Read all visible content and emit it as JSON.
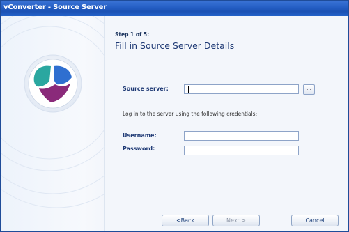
{
  "window": {
    "title": "vConverter - Source Server"
  },
  "wizard": {
    "step_label": "Step 1 of 5:",
    "heading": "Fill in Source Server Details"
  },
  "form": {
    "source_server_label": "Source server:",
    "source_server_value": "",
    "browse_label": "...",
    "credentials_text": "Log in to the server using the following credentials:",
    "username_label": "Username:",
    "username_value": "",
    "password_label": "Password:",
    "password_value": ""
  },
  "buttons": {
    "back": "<Back",
    "next": "Next >",
    "cancel": "Cancel"
  },
  "colors": {
    "titlebar": "#2660c6",
    "accent": "#1f3a75",
    "logo_teal": "#2aa7a0",
    "logo_blue": "#2f6fd0",
    "logo_purple": "#8a2a7a"
  }
}
